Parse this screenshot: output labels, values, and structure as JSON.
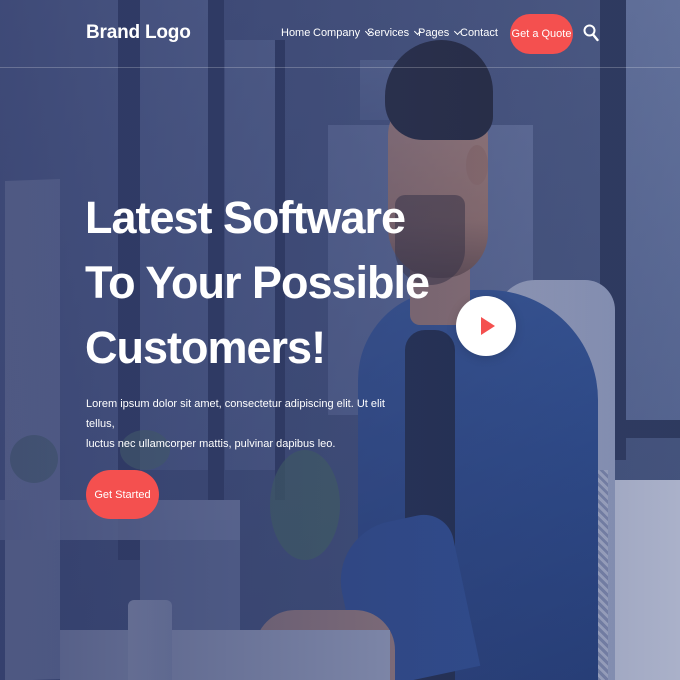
{
  "header": {
    "brand": "Brand Logo",
    "nav": [
      {
        "label": "Home"
      },
      {
        "label": "Company"
      },
      {
        "label": "Services"
      },
      {
        "label": "Pages"
      },
      {
        "label": "Contact"
      }
    ],
    "quote_button": "Get a Quote",
    "search_icon": "search-icon"
  },
  "hero": {
    "title_lines": [
      "Latest Software",
      "To Your Possible",
      "Customers!"
    ],
    "description_line1": "Lorem ipsum dolor sit amet, consectetur adipiscing elit. Ut elit tellus,",
    "description_line2": "luctus nec ullamcorper mattis, pulvinar dapibus leo.",
    "cta_label": "Get Started",
    "play_icon": "play-icon"
  },
  "colors": {
    "accent": "#f4504f",
    "overlay": "#303a69",
    "text": "#ffffff"
  }
}
